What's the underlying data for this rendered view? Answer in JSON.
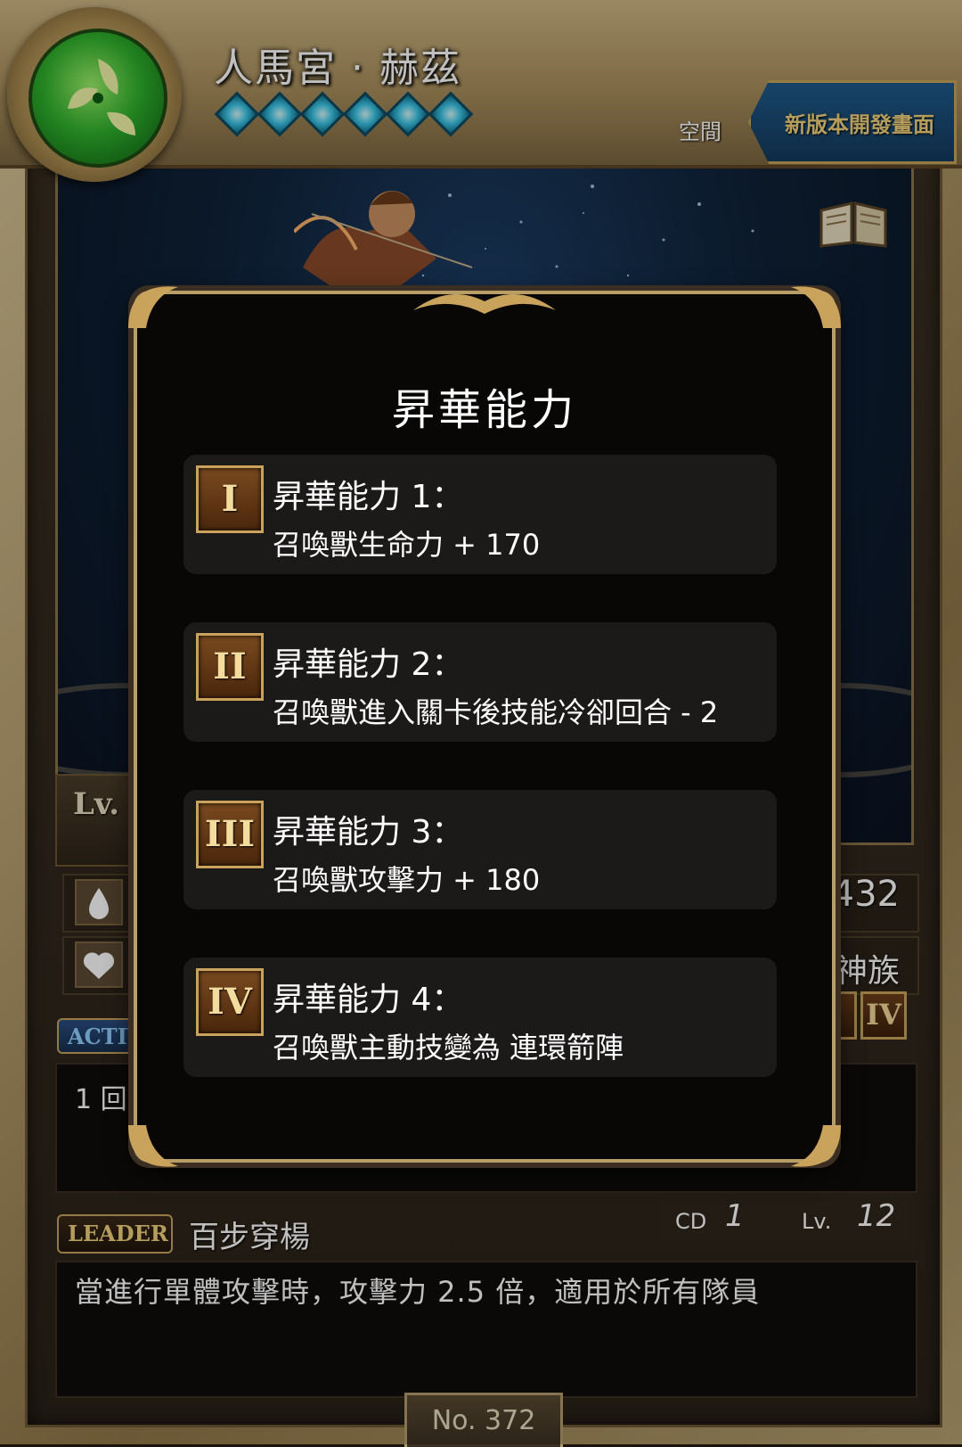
{
  "header": {
    "card_name": "人馬宮 · 赫茲",
    "rarity_stars": 6,
    "space_label": "空間",
    "new_version_button": "新版本開發畫面"
  },
  "stats": {
    "lv_label": "Lv.",
    "right_value_partial": ".432",
    "race": "神族"
  },
  "active_skill": {
    "tag": "ACTIV",
    "desc_partial": "1 回"
  },
  "leader_skill": {
    "tag": "LEADER",
    "name": "百步穿楊",
    "cd_label": "CD",
    "cd_value": "1",
    "lv_label": "Lv.",
    "lv_value": "12",
    "description": "當進行單體攻擊時，攻擊力 2.5 倍，適用於所有隊員"
  },
  "card_number": "No. 372",
  "modal": {
    "title": "昇華能力",
    "abilities": [
      {
        "numeral": "I",
        "title": "昇華能力 1：",
        "desc": "召喚獸生命力 + 170"
      },
      {
        "numeral": "II",
        "title": "昇華能力 2：",
        "desc": "召喚獸進入關卡後技能冷卻回合 - 2"
      },
      {
        "numeral": "III",
        "title": "昇華能力 3：",
        "desc": "召喚獸攻擊力 + 180"
      },
      {
        "numeral": "IV",
        "title": "昇華能力 4：",
        "desc": "召喚獸主動技變為 連環箭陣"
      }
    ]
  },
  "small_badges": [
    "I",
    "IV"
  ],
  "colors": {
    "attribute": "#2fb12c",
    "gold": "#c9a35b",
    "modal_bg": "#080706"
  },
  "icons": {
    "attribute": "wood-leaf-icon",
    "book": "book-icon",
    "hp": "heart-icon",
    "water": "water-drop-icon"
  }
}
